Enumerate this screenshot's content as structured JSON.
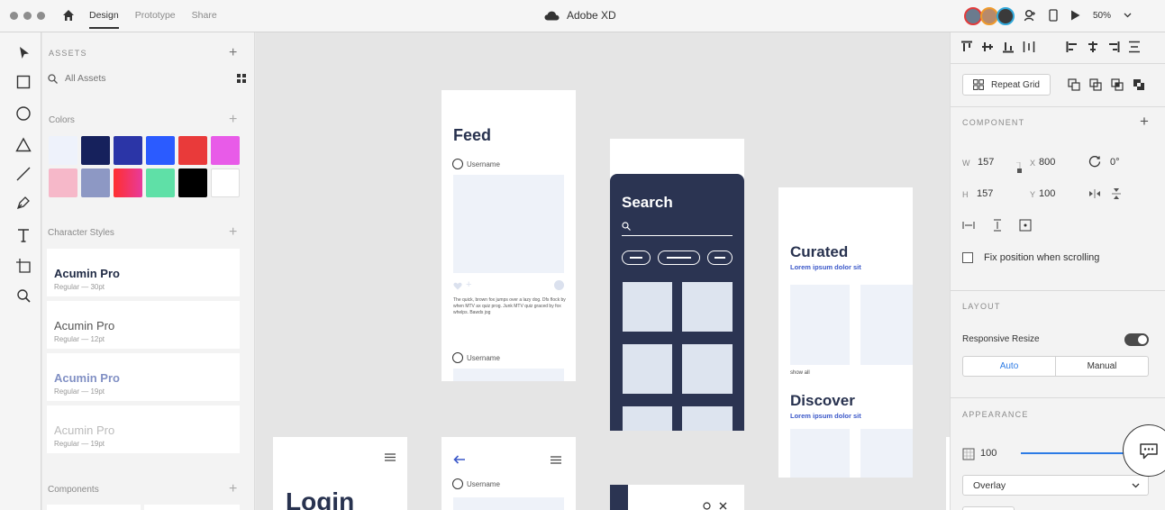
{
  "app": {
    "title": "Adobe XD"
  },
  "top_tabs": [
    {
      "label": "Design"
    },
    {
      "label": "Prototype"
    },
    {
      "label": "Share"
    }
  ],
  "zoom": "50%",
  "assets": {
    "header": "ASSETS",
    "search_placeholder": "All Assets",
    "colors_label": "Colors",
    "colors": [
      "#eef2fb",
      "#16215c",
      "#2b35a7",
      "#2b5bff",
      "#e93a3a",
      "#e85be8",
      "#f6b8c9",
      "#8d98c4",
      "#ee3a6f",
      "#5fe0a7",
      "#000000",
      "#ffffff"
    ],
    "char_styles_label": "Character Styles",
    "char_styles": [
      {
        "name": "Acumin Pro",
        "meta": "Regular — 30pt"
      },
      {
        "name": "Acumin Pro",
        "meta": "Regular — 12pt"
      },
      {
        "name": "Acumin Pro",
        "meta": "Regular — 19pt"
      },
      {
        "name": "Acumin Pro",
        "meta": "Regular — 19pt"
      }
    ],
    "components_label": "Components"
  },
  "canvas": {
    "feed": {
      "title": "Feed",
      "username": "Username",
      "body": "The quick, brown fox jumps over a lazy dog. Dfs flock by when MTV ax quiz prog. Junk MTV quiz graced by fox whelps. Bawds jog",
      "username2": "Username"
    },
    "search": {
      "title": "Search"
    },
    "curated": {
      "title": "Curated",
      "subtitle": "Lorem ipsum dolor sit",
      "show_all": "show all",
      "title2": "Discover",
      "subtitle2": "Lorem ipsum dolor sit"
    },
    "login": {
      "title": "Login"
    },
    "profile": {
      "username": "Username"
    }
  },
  "props": {
    "repeat_grid": "Repeat Grid",
    "component_label": "COMPONENT",
    "w_label": "W",
    "w": "157",
    "x_label": "X",
    "x": "800",
    "rotation": "0°",
    "h_label": "H",
    "h": "157",
    "y_label": "Y",
    "y": "100",
    "fix_position": "Fix position when scrolling",
    "layout_label": "LAYOUT",
    "responsive_resize": "Responsive Resize",
    "auto": "Auto",
    "manual": "Manual",
    "appearance_label": "APPEARANCE",
    "opacity": "100",
    "blend_mode": "Overlay"
  }
}
